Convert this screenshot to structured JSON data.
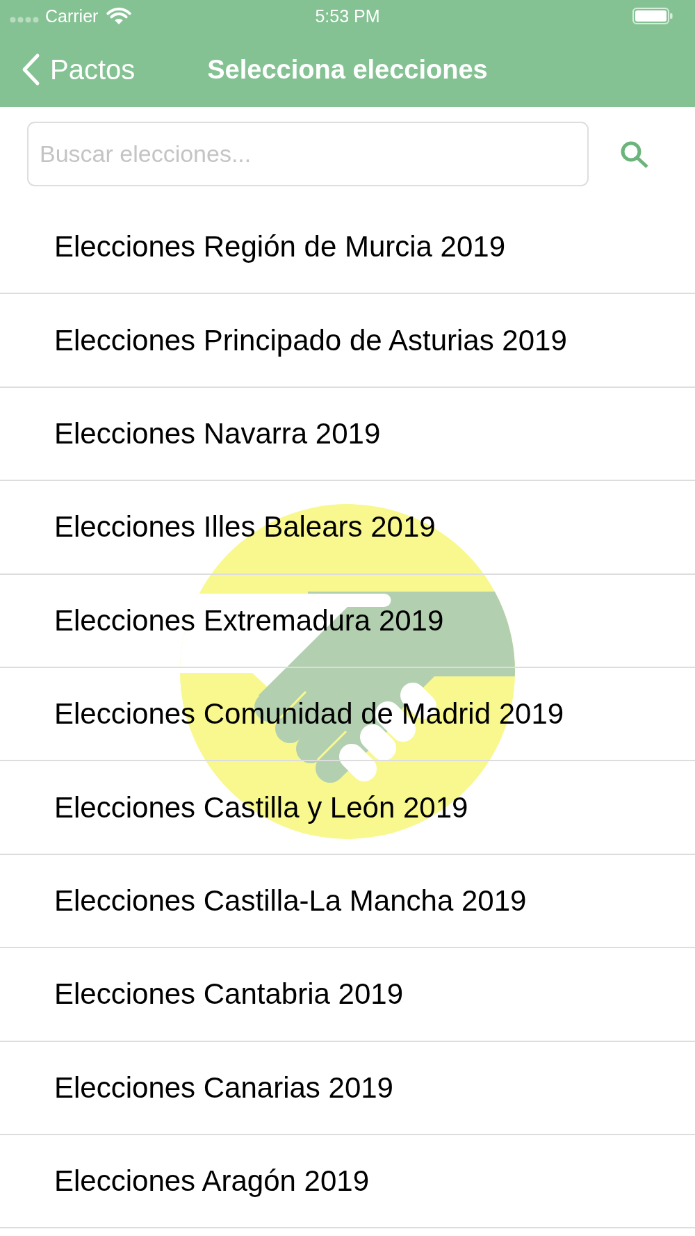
{
  "status_bar": {
    "carrier": "Carrier",
    "time": "5:53 PM"
  },
  "nav_bar": {
    "back_label": "Pactos",
    "title": "Selecciona elecciones"
  },
  "search": {
    "placeholder": "Buscar elecciones..."
  },
  "elections": [
    "Elecciones Región de Murcia 2019",
    "Elecciones Principado de Asturias 2019",
    "Elecciones Navarra 2019",
    "Elecciones Illes Balears 2019",
    "Elecciones Extremadura 2019",
    "Elecciones Comunidad de Madrid 2019",
    "Elecciones Castilla y León 2019",
    "Elecciones Castilla-La Mancha 2019",
    "Elecciones Cantabria 2019",
    "Elecciones Canarias 2019",
    "Elecciones Aragón 2019"
  ]
}
